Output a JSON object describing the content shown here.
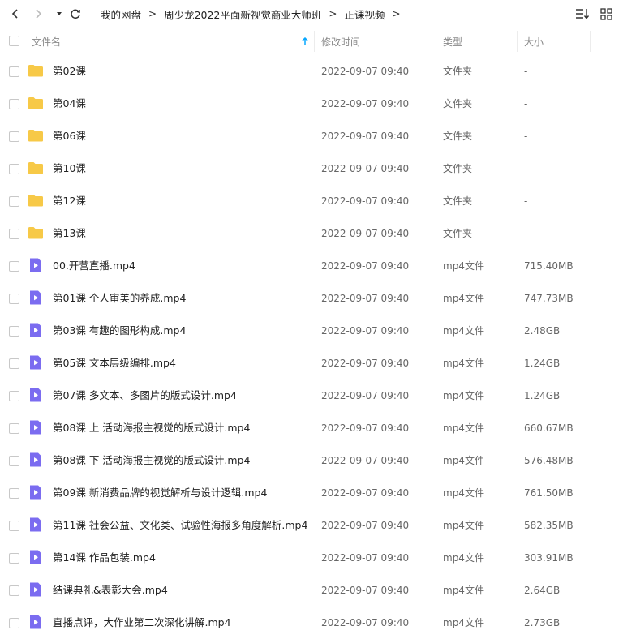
{
  "toolbar": {
    "back_icon": "chevron-left-icon",
    "forward_icon": "chevron-right-icon",
    "history_icon": "caret-down-icon",
    "refresh_icon": "refresh-icon",
    "sort_icon": "sort-list-icon",
    "grid_icon": "grid-view-icon"
  },
  "breadcrumb": {
    "items": [
      "我的网盘",
      "周少龙2022平面新视觉商业大师班",
      "正课视频"
    ],
    "separator": ">"
  },
  "header": {
    "name": "文件名",
    "modified": "修改时间",
    "type": "类型",
    "size": "大小",
    "sort_icon": "arrow-up-icon",
    "sort_color": "#06a7ff"
  },
  "colors": {
    "folder": "#f7c948",
    "video": "#7b6cf0"
  },
  "files": [
    {
      "name": "第02课",
      "date": "2022-09-07 09:40",
      "type": "文件夹",
      "size": "-",
      "kind": "folder"
    },
    {
      "name": "第04课",
      "date": "2022-09-07 09:40",
      "type": "文件夹",
      "size": "-",
      "kind": "folder"
    },
    {
      "name": "第06课",
      "date": "2022-09-07 09:40",
      "type": "文件夹",
      "size": "-",
      "kind": "folder"
    },
    {
      "name": "第10课",
      "date": "2022-09-07 09:40",
      "type": "文件夹",
      "size": "-",
      "kind": "folder"
    },
    {
      "name": "第12课",
      "date": "2022-09-07 09:40",
      "type": "文件夹",
      "size": "-",
      "kind": "folder"
    },
    {
      "name": "第13课",
      "date": "2022-09-07 09:40",
      "type": "文件夹",
      "size": "-",
      "kind": "folder"
    },
    {
      "name": "00.开营直播.mp4",
      "date": "2022-09-07 09:40",
      "type": "mp4文件",
      "size": "715.40MB",
      "kind": "video"
    },
    {
      "name": "第01课 个人审美的养成.mp4",
      "date": "2022-09-07 09:40",
      "type": "mp4文件",
      "size": "747.73MB",
      "kind": "video"
    },
    {
      "name": "第03课 有趣的图形构成.mp4",
      "date": "2022-09-07 09:40",
      "type": "mp4文件",
      "size": "2.48GB",
      "kind": "video"
    },
    {
      "name": "第05课 文本层级编排.mp4",
      "date": "2022-09-07 09:40",
      "type": "mp4文件",
      "size": "1.24GB",
      "kind": "video"
    },
    {
      "name": "第07课 多文本、多图片的版式设计.mp4",
      "date": "2022-09-07 09:40",
      "type": "mp4文件",
      "size": "1.24GB",
      "kind": "video"
    },
    {
      "name": "第08课 上 活动海报主视觉的版式设计.mp4",
      "date": "2022-09-07 09:40",
      "type": "mp4文件",
      "size": "660.67MB",
      "kind": "video"
    },
    {
      "name": "第08课 下 活动海报主视觉的版式设计.mp4",
      "date": "2022-09-07 09:40",
      "type": "mp4文件",
      "size": "576.48MB",
      "kind": "video"
    },
    {
      "name": "第09课 新消费品牌的视觉解析与设计逻辑.mp4",
      "date": "2022-09-07 09:40",
      "type": "mp4文件",
      "size": "761.50MB",
      "kind": "video"
    },
    {
      "name": "第11课 社会公益、文化类、试验性海报多角度解析.mp4",
      "date": "2022-09-07 09:40",
      "type": "mp4文件",
      "size": "582.35MB",
      "kind": "video"
    },
    {
      "name": "第14课 作品包装.mp4",
      "date": "2022-09-07 09:40",
      "type": "mp4文件",
      "size": "303.91MB",
      "kind": "video"
    },
    {
      "name": "结课典礼&表彰大会.mp4",
      "date": "2022-09-07 09:40",
      "type": "mp4文件",
      "size": "2.64GB",
      "kind": "video"
    },
    {
      "name": "直播点评，大作业第二次深化讲解.mp4",
      "date": "2022-09-07 09:40",
      "type": "mp4文件",
      "size": "2.73GB",
      "kind": "video"
    }
  ]
}
